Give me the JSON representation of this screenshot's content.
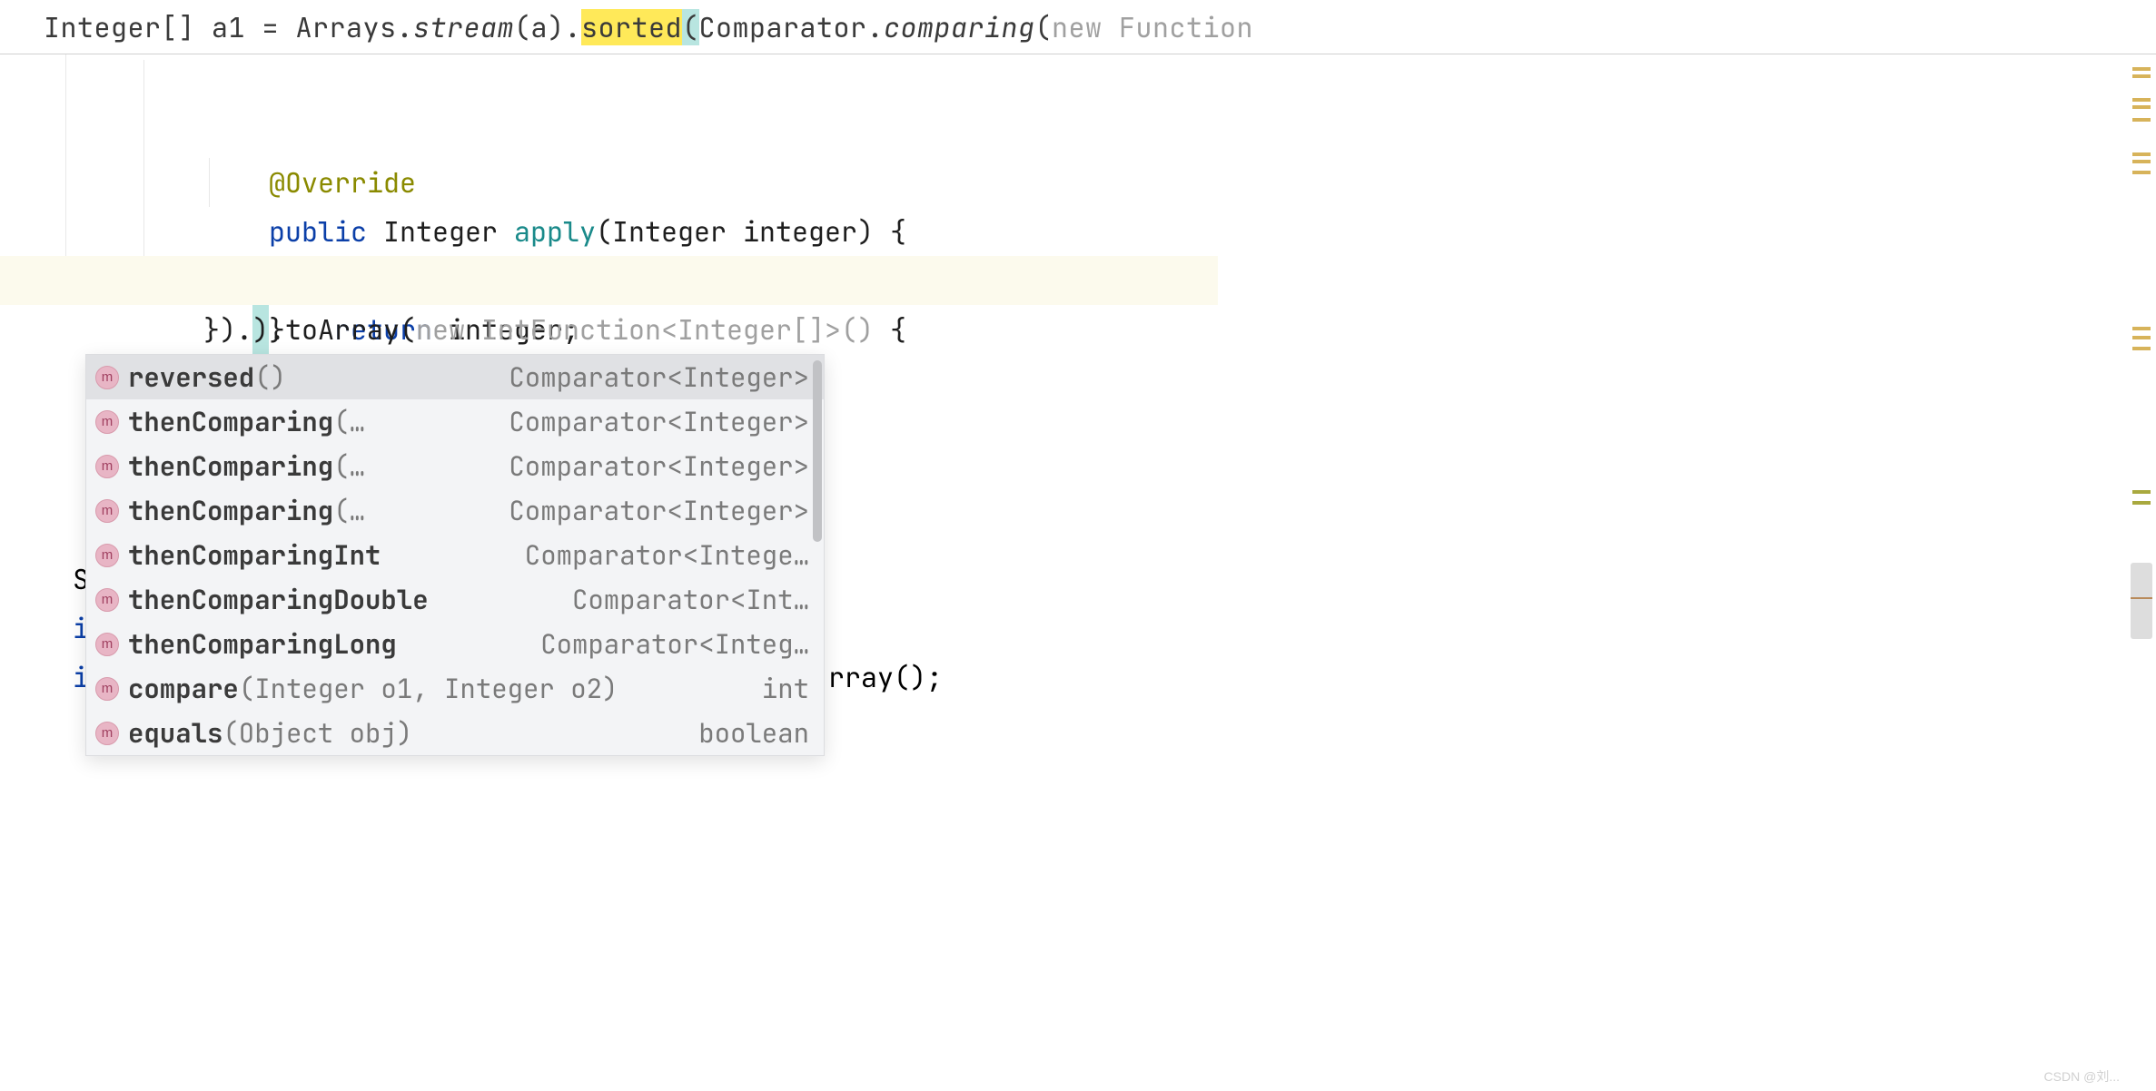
{
  "breadcrumb": {
    "t1": "Integer[] a1 = Arrays.",
    "t2": "stream",
    "t3": "(a).",
    "t4": "sorted",
    "t5": "(",
    "t6": "Comparator.",
    "t7": "comparing",
    "t8": "(",
    "t9": "new Function"
  },
  "code": {
    "l1": {
      "indent": "        ",
      "annot": "@Override"
    },
    "l2": {
      "indent": "        ",
      "kw1": "public",
      "sp1": " ",
      "type": "Integer ",
      "fn": "apply",
      "rest": "(Integer integer) {"
    },
    "l3": {
      "indent": "            ",
      "kw": "return",
      "rest": " integer;"
    },
    "l4": {
      "indent": "        ",
      "brace": "}"
    },
    "l5": {
      "indent": "    ",
      "pre": "}).",
      "caret": ")",
      "mid": ".toArray(",
      "hint1": "new",
      "hint_sp": " ",
      "hint2": "IntFunction<Integer[]>()",
      "post": " {"
    },
    "behind_row6": {
      "indent": "    ",
      "text": "}"
    },
    "behind_row7": {
      "text": "S"
    },
    "behind_row8": {
      "text": "i"
    },
    "behind_row9": {
      "text": "i",
      "tail": "rray();"
    }
  },
  "popup": {
    "items": [
      {
        "name": "reversed",
        "params": "()",
        "ret": "Comparator<Integer>",
        "selected": true
      },
      {
        "name": "thenComparing",
        "params": "(…",
        "ret": "Comparator<Integer>",
        "selected": false
      },
      {
        "name": "thenComparing",
        "params": "(…",
        "ret": "Comparator<Integer>",
        "selected": false
      },
      {
        "name": "thenComparing",
        "params": "(…",
        "ret": "Comparator<Integer>",
        "selected": false
      },
      {
        "name": "thenComparingInt",
        "params": "",
        "ret": "Comparator<Intege…",
        "selected": false
      },
      {
        "name": "thenComparingDouble",
        "params": "",
        "ret": "Comparator<Int…",
        "selected": false
      },
      {
        "name": "thenComparingLong",
        "params": "",
        "ret": "Comparator<Integ…",
        "selected": false
      },
      {
        "name": "compare",
        "params": "(Integer o1, Integer o2)",
        "ret": "int",
        "selected": false
      },
      {
        "name": "equals",
        "params": "(Object obj)",
        "ret": "boolean",
        "selected": false
      }
    ],
    "icon_letter": "m"
  },
  "watermark": "CSDN @刘..."
}
